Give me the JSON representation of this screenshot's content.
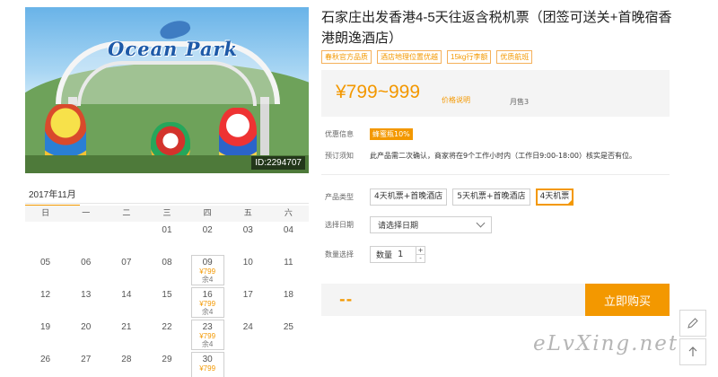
{
  "product": {
    "title": "石家庄出发香港4-5天往返含税机票（团签可送关+首晚宿香港朗逸酒店）",
    "image_id": "ID:2294707",
    "tags": [
      "春秋官方品质",
      "酒店地理位置优越",
      "15kg行李额",
      "优质航班"
    ]
  },
  "price": {
    "range": "¥799~999",
    "link": "价格说明",
    "sold": "月售3"
  },
  "info": {
    "discount_label": "优惠信息",
    "discount_badge": "蜂蜜瓶10%",
    "notice_label": "预订须知",
    "notice_text": "此产品需二次确认，商家将在9个工作小时内（工作日9:00-18:00）核实是否有位。"
  },
  "options": {
    "type_label": "产品类型",
    "types": [
      "4天机票+首晚酒店",
      "5天机票+首晚酒店",
      "4天机票"
    ],
    "selected_index": 2,
    "date_label": "选择日期",
    "date_placeholder": "请选择日期",
    "qty_label": "数量选择",
    "qty_field": "数量",
    "qty_value": "1",
    "qty_plus": "+",
    "qty_minus": "-"
  },
  "buy": {
    "total": "--",
    "button": "立即购买"
  },
  "calendar": {
    "month": "2017年11月",
    "weekdays": [
      "日",
      "一",
      "二",
      "三",
      "四",
      "五",
      "六"
    ],
    "rows": [
      [
        {
          "d": ""
        },
        {
          "d": ""
        },
        {
          "d": ""
        },
        {
          "d": "01"
        },
        {
          "d": "02"
        },
        {
          "d": "03"
        },
        {
          "d": "04"
        }
      ],
      [
        {
          "d": "05"
        },
        {
          "d": "06"
        },
        {
          "d": "07"
        },
        {
          "d": "08"
        },
        {
          "d": "09",
          "p": "¥799",
          "s": "余4"
        },
        {
          "d": "10"
        },
        {
          "d": "11"
        }
      ],
      [
        {
          "d": "12"
        },
        {
          "d": "13"
        },
        {
          "d": "14"
        },
        {
          "d": "15"
        },
        {
          "d": "16",
          "p": "¥799",
          "s": "余4"
        },
        {
          "d": "17"
        },
        {
          "d": "18"
        }
      ],
      [
        {
          "d": "19"
        },
        {
          "d": "20"
        },
        {
          "d": "21"
        },
        {
          "d": "22"
        },
        {
          "d": "23",
          "p": "¥799",
          "s": "余4"
        },
        {
          "d": "24"
        },
        {
          "d": "25"
        }
      ],
      [
        {
          "d": "26"
        },
        {
          "d": "27"
        },
        {
          "d": "28"
        },
        {
          "d": "29"
        },
        {
          "d": "30",
          "p": "¥799",
          "s": ""
        },
        {
          "d": ""
        },
        {
          "d": ""
        }
      ]
    ]
  },
  "watermark": "eLvXing.net",
  "icons": {
    "edit": "pencil-icon",
    "top": "arrow-up-icon"
  },
  "colors": {
    "accent": "#f39800"
  }
}
